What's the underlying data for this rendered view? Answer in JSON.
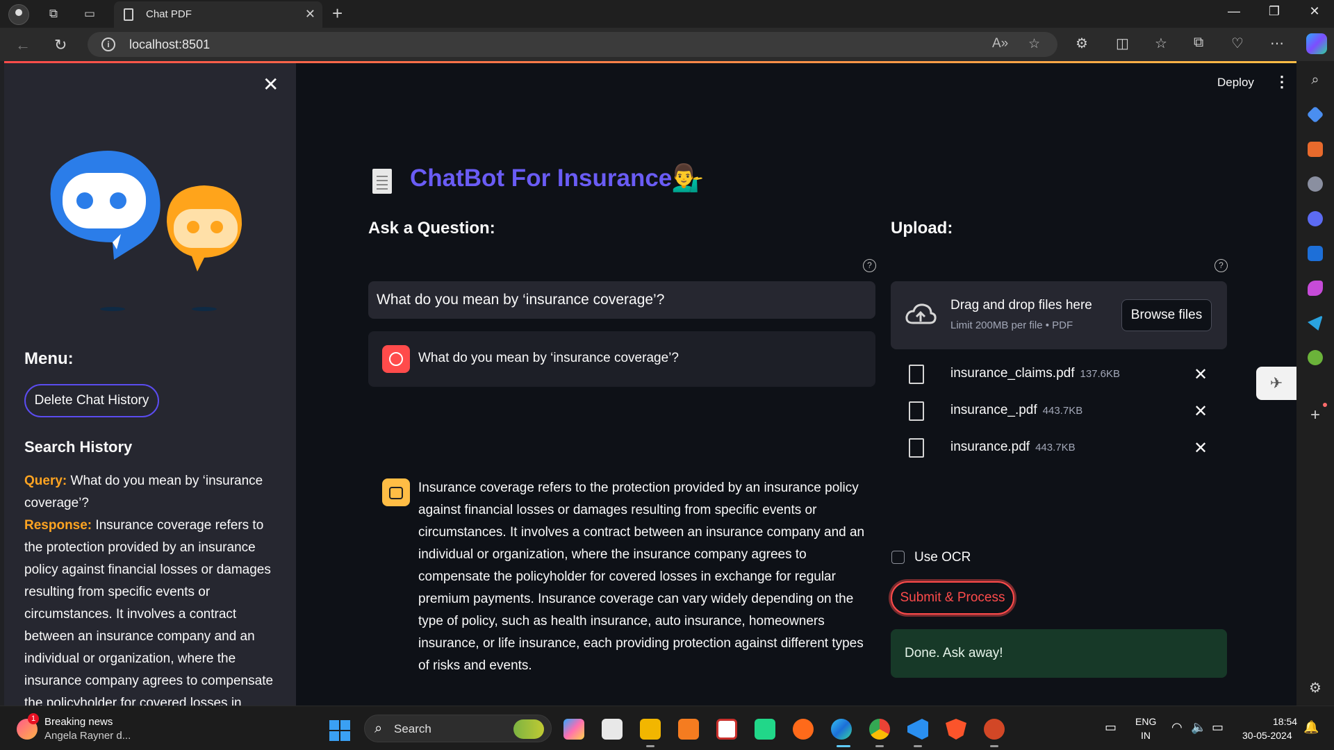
{
  "browser": {
    "tab_title": "Chat PDF",
    "url": "localhost:8501"
  },
  "app": {
    "deploy_label": "Deploy",
    "title": "ChatBot For Insurance",
    "sidebar": {
      "menu_title": "Menu:",
      "delete_button": "Delete Chat History",
      "history_title": "Search History",
      "history": [
        {
          "query_label": "Query:",
          "query": "What do you mean by ‘insurance coverage’?",
          "response_label": "Response:",
          "response": "Insurance coverage refers to the protection provided by an insurance policy against financial losses or damages resulting from specific events or circumstances. It involves a contract between an insurance company and an individual or organization, where the insurance company agrees to compensate the policyholder for covered losses in"
        }
      ]
    },
    "ask": {
      "heading": "Ask a Question:",
      "input_value": "What do you mean by ‘insurance coverage’?"
    },
    "chat": {
      "user_message": "What do you mean by ‘insurance coverage’?",
      "bot_message": "Insurance coverage refers to the protection provided by an insurance policy against financial losses or damages resulting from specific events or circumstances. It involves a contract between an insurance company and an individual or organization, where the insurance company agrees to compensate the policyholder for covered losses in exchange for regular premium payments. Insurance coverage can vary widely depending on the type of policy, such as health insurance, auto insurance, homeowners insurance, or life insurance, each providing protection against different types of risks and events."
    },
    "upload": {
      "heading": "Upload:",
      "drag_text": "Drag and drop files here",
      "limit_text": "Limit 200MB per file • PDF",
      "browse_label": "Browse files",
      "files": [
        {
          "name": "insurance_claims.pdf",
          "size": "137.6KB"
        },
        {
          "name": "insurance_.pdf",
          "size": "443.7KB"
        },
        {
          "name": "insurance.pdf",
          "size": "443.7KB"
        }
      ],
      "ocr_label": "Use OCR",
      "ocr_checked": false,
      "submit_label": "Submit & Process",
      "status": "Done. Ask away!"
    }
  },
  "taskbar": {
    "news_badge": "1",
    "news_title": "Breaking news",
    "news_sub": "Angela Rayner d...",
    "search_label": "Search",
    "lang_top": "ENG",
    "lang_bottom": "IN",
    "time": "18:54",
    "date": "30-05-2024"
  },
  "colors": {
    "accent": "#6a5cf5",
    "primary": "#ff4b4b",
    "history_label": "#ffa421",
    "success_bg": "#173928"
  }
}
